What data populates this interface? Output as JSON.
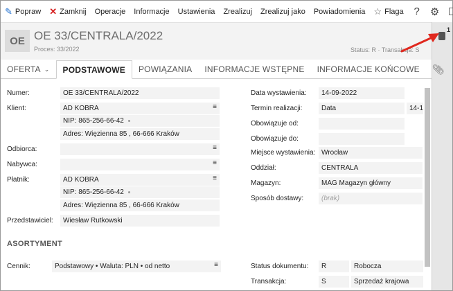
{
  "toolbar": {
    "popraw": "Popraw",
    "zamknij": "Zamknij",
    "operacje": "Operacje",
    "informacje": "Informacje",
    "ustawienia": "Ustawienia",
    "zrealizuj": "Zrealizuj",
    "zrealizuj_jako": "Zrealizuj jako",
    "powiadomienia": "Powiadomienia",
    "flaga": "Flaga",
    "help": "?"
  },
  "header": {
    "badge": "OE",
    "title": "OE 33/CENTRALA/2022",
    "process": "Proces:  33/2022",
    "status_line": "Status:  R  ·  Transakcja:  S",
    "side_count": "1"
  },
  "tabs": [
    "OFERTA",
    "PODSTAWOWE",
    "POWIĄZANIA",
    "INFORMACJE WSTĘPNE",
    "INFORMACJE KOŃCOWE"
  ],
  "left": {
    "numer_label": "Numer:",
    "numer": "OE 33/CENTRALA/2022",
    "klient_label": "Klient:",
    "klient": "AD KOBRA",
    "klient_nip": "NIP:  865-256-66-42",
    "klient_adres": "Adres:  Więzienna  85 , 66-666 Kraków",
    "odbiorca_label": "Odbiorca:",
    "nabywca_label": "Nabywca:",
    "platnik_label": "Płatnik:",
    "platnik": "AD KOBRA",
    "platnik_nip": "NIP:  865-256-66-42",
    "platnik_adres": "Adres:  Więzienna  85 , 66-666 Kraków",
    "przedst_label": "Przedstawiciel:",
    "przedst": "Wiesław Rutkowski"
  },
  "right": {
    "data_wyst_label": "Data wystawienia:",
    "data_wyst": "14-09-2022",
    "termin_label": "Termin realizacji:",
    "termin": "Data",
    "termin_val": "14-1",
    "obow_od_label": "Obowiązuje od:",
    "obow_do_label": "Obowiązuje do:",
    "miejsce_label": "Miejsce wystawienia:",
    "miejsce": "Wrocław",
    "oddzial_label": "Oddział:",
    "oddzial": "CENTRALA",
    "magazyn_label": "Magazyn:",
    "magazyn": "MAG  Magazyn główny",
    "sposob_label": "Sposób dostawy:",
    "sposob": "(brak)"
  },
  "asortyment": {
    "title": "ASORTYMENT",
    "cennik_label": "Cennik:",
    "cennik": "Podstawowy • Waluta: PLN • od netto",
    "status_label": "Status dokumentu:",
    "status_code": "R",
    "status_name": "Robocza",
    "transakcja_label": "Transakcja:",
    "transakcja_code": "S",
    "transakcja_name": "Sprzedaż krajowa"
  },
  "menu_glyph": "≡",
  "colors": {
    "accent": "#1f6fd0",
    "close_red": "#d62020",
    "arrow": "#e0281e"
  }
}
